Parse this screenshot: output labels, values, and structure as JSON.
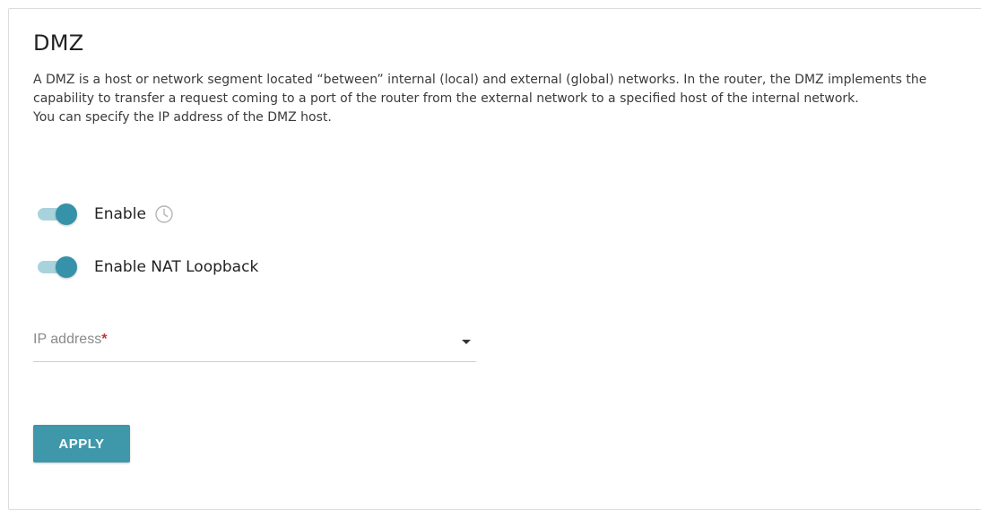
{
  "page": {
    "title": "DMZ",
    "description_lines": [
      "A DMZ is a host or network segment located “between” internal (local) and external (global) networks. In the router, the DMZ implements the capability to transfer a request coming to a port of the router from the external network to a specified host of the internal network.",
      "You can specify the IP address of the DMZ host."
    ]
  },
  "toggles": {
    "enable": {
      "label": "Enable",
      "on": true
    },
    "nat_loopback": {
      "label": "Enable NAT Loopback",
      "on": true
    }
  },
  "ip_field": {
    "placeholder": "IP address",
    "required_mark": "*",
    "value": ""
  },
  "actions": {
    "apply_label": "APPLY"
  },
  "colors": {
    "accent": "#3f97aa",
    "toggle_thumb": "#3592a9",
    "toggle_track": "#a9d3dc",
    "required": "#d32f2f"
  },
  "icons": {
    "schedule": "clock-icon",
    "dropdown": "chevron-down-icon"
  }
}
